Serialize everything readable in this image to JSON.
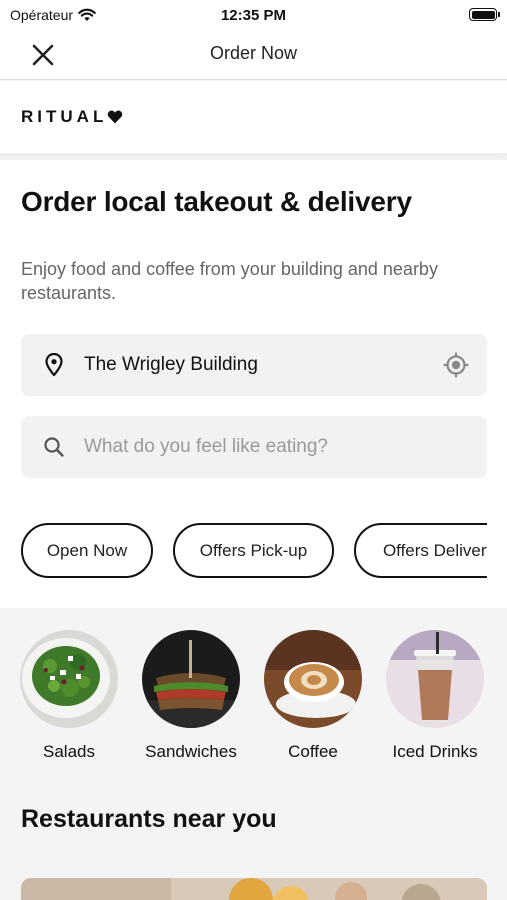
{
  "status_bar": {
    "carrier": "Opérateur",
    "time": "12:35 PM"
  },
  "nav": {
    "title": "Order Now",
    "close_icon": "close-icon"
  },
  "brand": {
    "logo_text": "RITUAL",
    "logo_mark": "heart-icon"
  },
  "hero": {
    "headline": "Order local takeout & delivery",
    "subtext": "Enjoy food and coffee from your building and nearby restaurants."
  },
  "location": {
    "value": "The Wrigley Building",
    "icon": "map-pin-icon",
    "locate_icon": "crosshair-icon"
  },
  "search": {
    "placeholder": "What do you feel like eating?",
    "icon": "search-icon"
  },
  "filters": [
    {
      "label": "Open Now"
    },
    {
      "label": "Offers Pick-up"
    },
    {
      "label": "Offers Delivery"
    }
  ],
  "categories": [
    {
      "label": "Salads",
      "image": "salad-photo"
    },
    {
      "label": "Sandwiches",
      "image": "sandwich-photo"
    },
    {
      "label": "Coffee",
      "image": "latte-photo"
    },
    {
      "label": "Iced Drinks",
      "image": "iced-drink-photo"
    }
  ],
  "restaurants": {
    "title": "Restaurants near you"
  },
  "colors": {
    "background": "#f4f4f4",
    "surface": "#ffffff",
    "field": "#f2f2f2",
    "text": "#111111",
    "muted": "#9a9a9a"
  }
}
